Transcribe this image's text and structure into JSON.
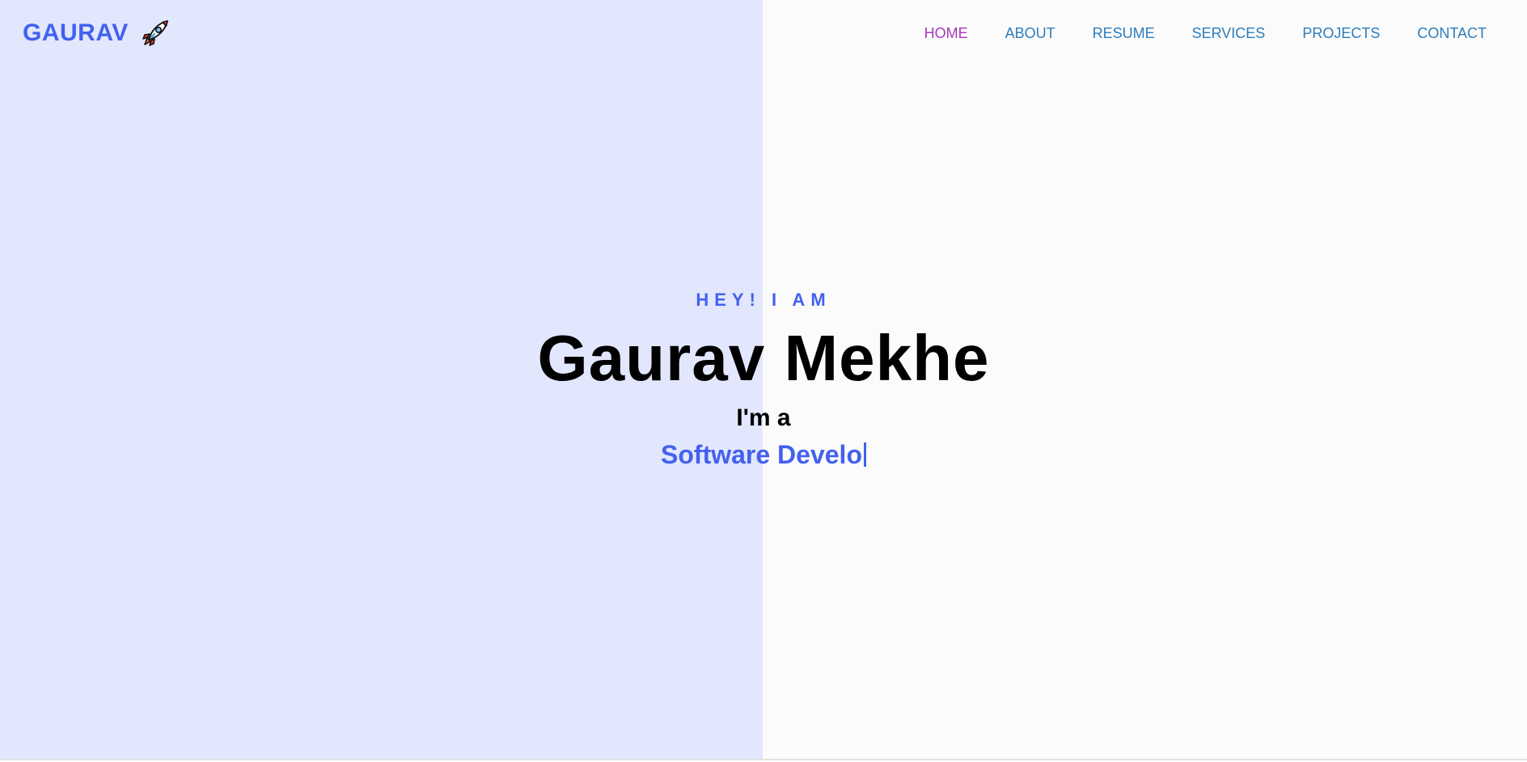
{
  "brand": {
    "name": "GAURAV",
    "icon": "rocket-icon"
  },
  "nav": {
    "items": [
      {
        "label": "HOME",
        "active": true
      },
      {
        "label": "ABOUT",
        "active": false
      },
      {
        "label": "RESUME",
        "active": false
      },
      {
        "label": "SERVICES",
        "active": false
      },
      {
        "label": "PROJECTS",
        "active": false
      },
      {
        "label": "CONTACT",
        "active": false
      }
    ]
  },
  "hero": {
    "greeting": "HEY! I AM",
    "name": "Gaurav Mekhe",
    "intro": "I'm a",
    "typed_role": "Software Develo"
  },
  "colors": {
    "accent": "#4361ee",
    "nav_link": "#2e7dbb",
    "nav_active": "#a33ab8",
    "left_panel": "#e2e7fe",
    "background": "#fbfbfb"
  }
}
